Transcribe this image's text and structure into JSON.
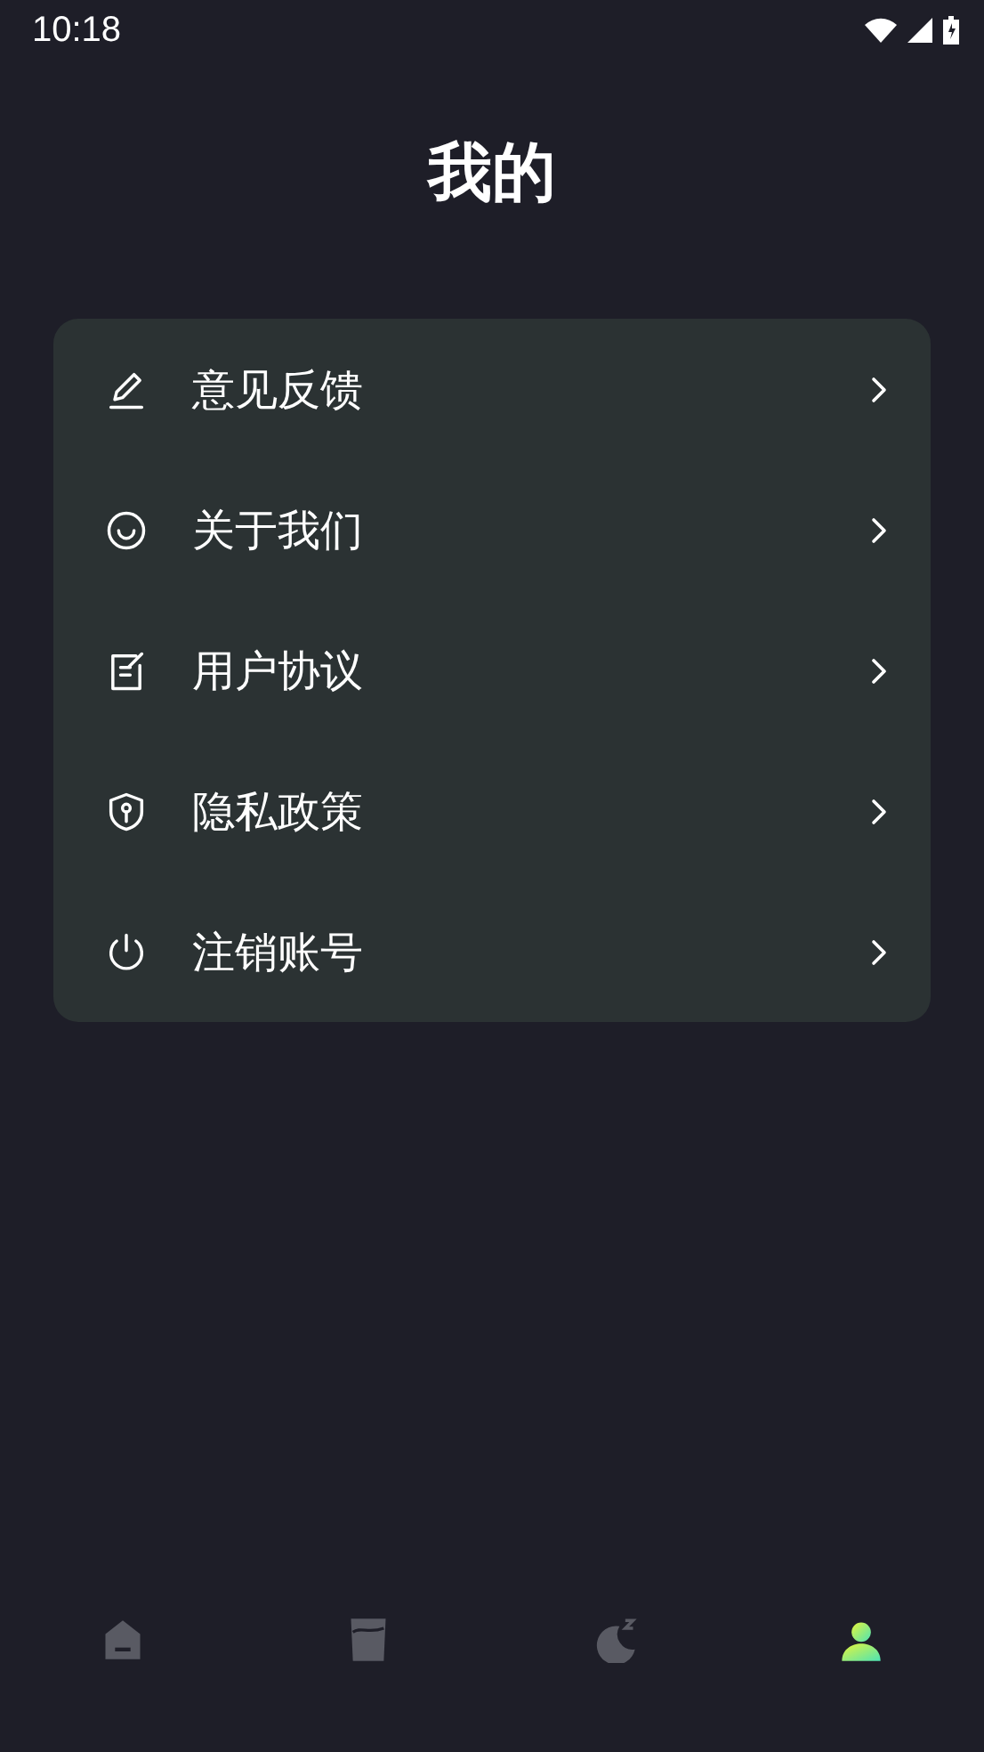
{
  "status_bar": {
    "time": "10:18"
  },
  "title": "我的",
  "menu": [
    {
      "kind": "feedback",
      "label": "意见反馈"
    },
    {
      "kind": "about",
      "label": "关于我们"
    },
    {
      "kind": "agreement",
      "label": "用户协议"
    },
    {
      "kind": "privacy",
      "label": "隐私政策"
    },
    {
      "kind": "logout",
      "label": "注销账号"
    }
  ],
  "tab_bar": [
    {
      "kind": "home",
      "selected": false
    },
    {
      "kind": "cup",
      "selected": false
    },
    {
      "kind": "sleep",
      "selected": false
    },
    {
      "kind": "profile",
      "selected": true
    }
  ]
}
